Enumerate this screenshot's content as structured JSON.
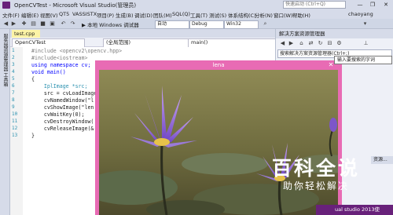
{
  "titlebar": {
    "title": "OpenCVTest - Microsoft Visual Studio(管理员)",
    "quick_launch_placeholder": "快速启动 (Ctrl+Q)",
    "minimize": "—",
    "restore": "❐",
    "close": "✕"
  },
  "menubar": {
    "items": [
      "文件(F)",
      "编辑(E)",
      "视图(V)",
      "QT5",
      "VASSISTX",
      "项目(P)",
      "生成(B)",
      "调试(D)",
      "团队(M)",
      "SQL(Q)",
      "工具(T)",
      "测试(S)",
      "体系结构(C)",
      "分析(N)",
      "窗口(W)",
      "帮助(H)"
    ],
    "user": "chaoyang"
  },
  "toolbar": {
    "run_label": "▶ 本地 Windows 调试器",
    "auto_combo": "自动",
    "config_combo": "Debug",
    "platform_combo": "Win32"
  },
  "lefttabs": {
    "label": "服务器资源管理器 工具箱"
  },
  "editor": {
    "tab_label": "test.cpp",
    "nav_project": "OpenCVTest",
    "nav_scope": "(全局范围)",
    "nav_member": "main()",
    "lines": [
      "#include <opencv2\\opencv.hpp>",
      "#include<iostream>",
      "using namespace cv;",
      "void main()",
      "{",
      "    IplImage *src;",
      "    src = cvLoadImage(",
      "    cvNamedWindow(\"l",
      "    cvShowImage(\"len",
      "    cvWaitKey(0);",
      "    cvDestroyWindow(",
      "    cvReleaseImage(&",
      "}"
    ],
    "line_numbers": [
      "1",
      "2",
      "3",
      "4",
      "5",
      "6",
      "7",
      "8",
      "9",
      "10",
      "11",
      "12",
      "13"
    ]
  },
  "rightpanel": {
    "title": "解决方案资源管理器",
    "search_placeholder": "搜索解决方案资源管理器(Ctrl+;)",
    "tooltip": "输入要搜索的字词",
    "bottom_tab": "资源..."
  },
  "image_window": {
    "title": "lena",
    "close": "✕"
  },
  "statusbar": {
    "text": "ual studio 2013使"
  },
  "watermark": {
    "big": "百科全说",
    "small": "助你轻松解决"
  },
  "colors": {
    "accent": "#68217a",
    "image_frame": "#e86bb4",
    "doc_tab": "#fcf3a6"
  }
}
